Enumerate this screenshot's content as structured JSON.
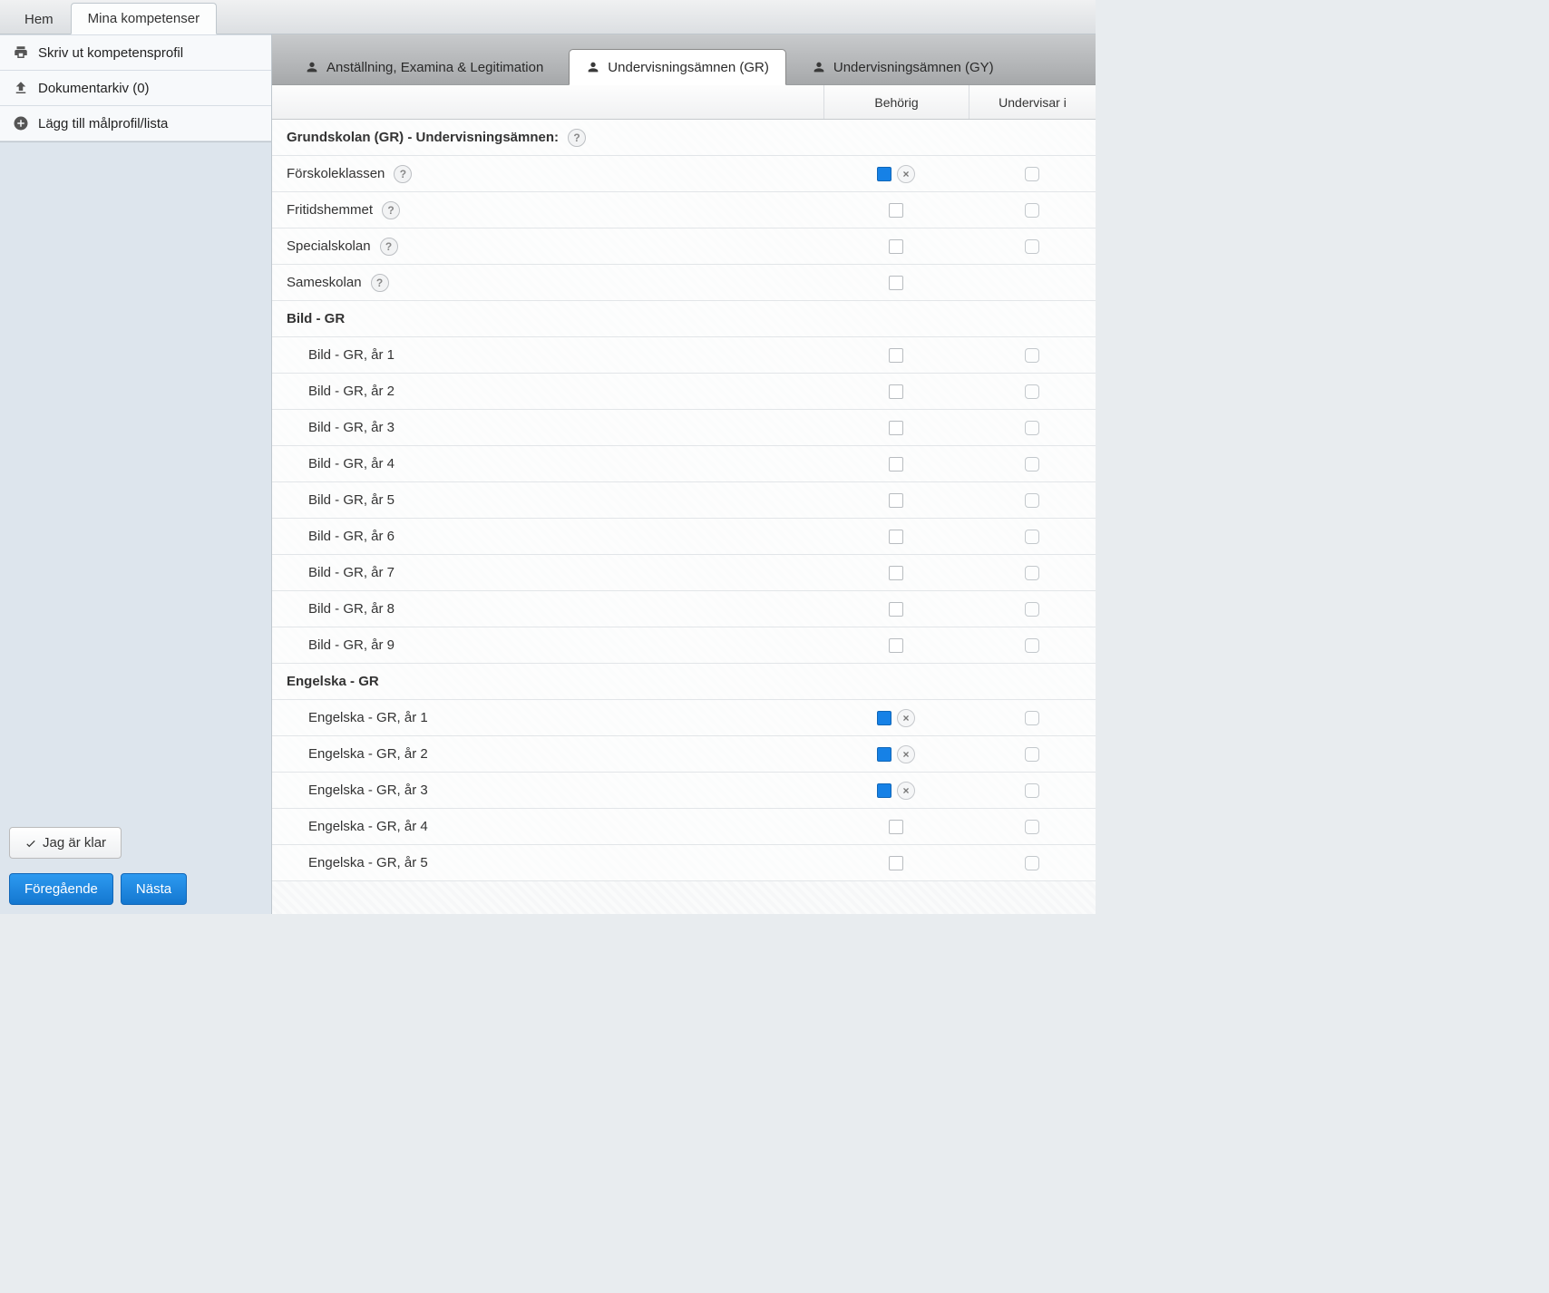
{
  "topTabs": {
    "home": "Hem",
    "competences": "Mina kompetenser"
  },
  "sidebar": {
    "print": "Skriv ut kompetensprofil",
    "archive": "Dokumentarkiv (0)",
    "addProfile": "Lägg till målprofil/lista",
    "done": "Jag är klar",
    "prev": "Föregående",
    "next": "Nästa"
  },
  "contentTabs": {
    "t0": "Anställning, Examina & Legitimation",
    "t1": "Undervisningsämnen (GR)",
    "t2": "Undervisningsämnen (GY)"
  },
  "columns": {
    "c2": "Behörig",
    "c3": "Undervisar i"
  },
  "rows": [
    {
      "type": "group",
      "label": "Grundskolan (GR) - Undervisningsämnen:",
      "help": true,
      "behorig": null,
      "undervisar": null
    },
    {
      "type": "item",
      "indent": 1,
      "label": "Förskoleklassen",
      "help": true,
      "behorig": "filled",
      "undervisar": "empty"
    },
    {
      "type": "item",
      "indent": 1,
      "label": "Fritidshemmet",
      "help": true,
      "behorig": "empty",
      "undervisar": "empty"
    },
    {
      "type": "item",
      "indent": 1,
      "label": "Specialskolan",
      "help": true,
      "behorig": "empty",
      "undervisar": "empty"
    },
    {
      "type": "item",
      "indent": 1,
      "label": "Sameskolan",
      "help": true,
      "behorig": "empty",
      "undervisar": null
    },
    {
      "type": "group",
      "label": "Bild - GR",
      "help": false,
      "behorig": null,
      "undervisar": null
    },
    {
      "type": "item",
      "indent": 2,
      "label": "Bild - GR, år 1",
      "help": false,
      "behorig": "empty",
      "undervisar": "empty"
    },
    {
      "type": "item",
      "indent": 2,
      "label": "Bild - GR, år 2",
      "help": false,
      "behorig": "empty",
      "undervisar": "empty"
    },
    {
      "type": "item",
      "indent": 2,
      "label": "Bild - GR, år 3",
      "help": false,
      "behorig": "empty",
      "undervisar": "empty"
    },
    {
      "type": "item",
      "indent": 2,
      "label": "Bild - GR, år 4",
      "help": false,
      "behorig": "empty",
      "undervisar": "empty"
    },
    {
      "type": "item",
      "indent": 2,
      "label": "Bild - GR, år 5",
      "help": false,
      "behorig": "empty",
      "undervisar": "empty"
    },
    {
      "type": "item",
      "indent": 2,
      "label": "Bild - GR, år 6",
      "help": false,
      "behorig": "empty",
      "undervisar": "empty"
    },
    {
      "type": "item",
      "indent": 2,
      "label": "Bild - GR, år 7",
      "help": false,
      "behorig": "empty",
      "undervisar": "empty"
    },
    {
      "type": "item",
      "indent": 2,
      "label": "Bild - GR, år 8",
      "help": false,
      "behorig": "empty",
      "undervisar": "empty"
    },
    {
      "type": "item",
      "indent": 2,
      "label": "Bild - GR, år 9",
      "help": false,
      "behorig": "empty",
      "undervisar": "empty"
    },
    {
      "type": "group",
      "label": "Engelska - GR",
      "help": false,
      "behorig": null,
      "undervisar": null
    },
    {
      "type": "item",
      "indent": 2,
      "label": "Engelska - GR, år 1",
      "help": false,
      "behorig": "filled",
      "undervisar": "empty"
    },
    {
      "type": "item",
      "indent": 2,
      "label": "Engelska - GR, år 2",
      "help": false,
      "behorig": "filled",
      "undervisar": "empty"
    },
    {
      "type": "item",
      "indent": 2,
      "label": "Engelska - GR, år 3",
      "help": false,
      "behorig": "filled",
      "undervisar": "empty"
    },
    {
      "type": "item",
      "indent": 2,
      "label": "Engelska - GR, år 4",
      "help": false,
      "behorig": "empty",
      "undervisar": "empty"
    },
    {
      "type": "item",
      "indent": 2,
      "label": "Engelska - GR, år 5",
      "help": false,
      "behorig": "empty",
      "undervisar": "empty"
    }
  ]
}
